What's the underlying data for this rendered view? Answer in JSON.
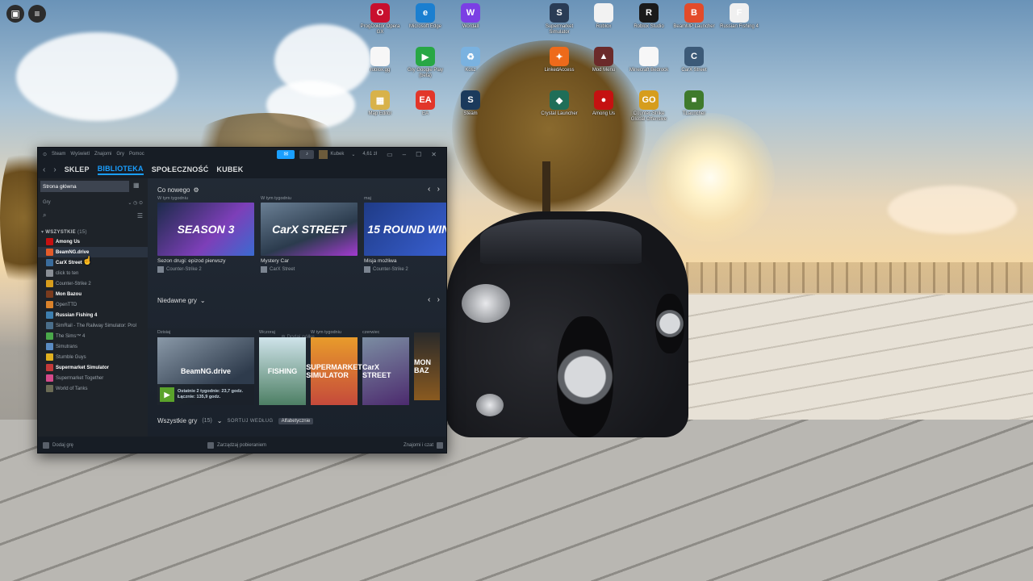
{
  "desktop": {
    "top_left": {
      "home_icon": "roblox-logo-icon",
      "menu_icon": "hamburger-icon"
    },
    "icons": [
      {
        "label": "ProgDoktór Opera GX",
        "color": "#c8102e",
        "glyph": "O",
        "col": 0,
        "row": 0
      },
      {
        "label": "Microsoft Edge",
        "color": "#1b7fd0",
        "glyph": "e",
        "col": 1,
        "row": 0
      },
      {
        "label": "Wordall",
        "color": "#7b3fe4",
        "glyph": "W",
        "col": 2,
        "row": 0
      },
      {
        "label": "Supermarket Simulator",
        "color": "#2a3c55",
        "glyph": "S",
        "col": 4,
        "row": 0
      },
      {
        "label": "Roblox",
        "color": "#f2f2f2",
        "glyph": "",
        "col": 5,
        "row": 0
      },
      {
        "label": "Roblox Studio",
        "color": "#1a1a1a",
        "glyph": "R",
        "col": 6,
        "row": 0
      },
      {
        "label": "BeamMP Launcher",
        "color": "#e34b2a",
        "glyph": "B",
        "col": 7,
        "row": 0
      },
      {
        "label": "Russian Fishing 4",
        "color": "#f0f0f0",
        "glyph": "F",
        "col": 8,
        "row": 0
      },
      {
        "label": "roblox.gg",
        "color": "#f7f7f7",
        "glyph": "",
        "col": 0,
        "row": 1
      },
      {
        "label": "Gry Google Play (beta)",
        "color": "#28a745",
        "glyph": "▶",
        "col": 1,
        "row": 1
      },
      {
        "label": "Kosz",
        "color": "#7ab2e0",
        "glyph": "♻",
        "col": 2,
        "row": 1
      },
      {
        "label": "LinkedAccess",
        "color": "#ee6a1a",
        "glyph": "✦",
        "col": 4,
        "row": 1
      },
      {
        "label": "Mod Menu",
        "color": "#6b2a2a",
        "glyph": "▲",
        "col": 5,
        "row": 1
      },
      {
        "label": "Minecraft Bedrock",
        "color": "#f7f7f7",
        "glyph": "",
        "col": 6,
        "row": 1
      },
      {
        "label": "CarX Street",
        "color": "#3c5a78",
        "glyph": "C",
        "col": 7,
        "row": 1
      },
      {
        "label": "Map Editor",
        "color": "#d8b24a",
        "glyph": "▦",
        "col": 0,
        "row": 2
      },
      {
        "label": "EA",
        "color": "#e2362a",
        "glyph": "EA",
        "col": 1,
        "row": 2
      },
      {
        "label": "Steam",
        "color": "#1b3a5c",
        "glyph": "S",
        "col": 2,
        "row": 2
      },
      {
        "label": "Crystal Launcher",
        "color": "#1f6e58",
        "glyph": "◆",
        "col": 4,
        "row": 2
      },
      {
        "label": "Among Us",
        "color": "#c51111",
        "glyph": "●",
        "col": 5,
        "row": 2
      },
      {
        "label": "Counter-Strike Global Offensive",
        "color": "#d69d1d",
        "glyph": "GO",
        "col": 6,
        "row": 2
      },
      {
        "label": "TLauncher",
        "color": "#3f7a2c",
        "glyph": "■",
        "col": 7,
        "row": 2
      }
    ]
  },
  "steam": {
    "titlebar": {
      "menu": [
        "Steam",
        "Wyświetl",
        "Znajomi",
        "Gry",
        "Pomoc"
      ],
      "user_name": "Kubek",
      "balance": "4,61 zł",
      "notif_icon": "megaphone-icon",
      "bell_icon": "bell-icon"
    },
    "nav": {
      "back": "‹",
      "forward": "›",
      "links": [
        "SKLEP",
        "BIBLIOTEKA",
        "SPOŁECZNOŚĆ",
        "KUBEK"
      ],
      "active": 1
    },
    "sidebar": {
      "home": "Strona główna",
      "filter": "Gry",
      "category": "WSZYSTKIE",
      "category_count": "(15)",
      "games": [
        {
          "name": "Among Us",
          "bold": true,
          "color": "#c51111"
        },
        {
          "name": "BeamNG.drive",
          "bold": true,
          "color": "#e35b2a",
          "selected": true
        },
        {
          "name": "CarX Street",
          "bold": true,
          "color": "#3a6c9c"
        },
        {
          "name": "click to ten",
          "bold": false,
          "color": "#8a8f96"
        },
        {
          "name": "Counter-Strike 2",
          "bold": false,
          "color": "#d69d1d"
        },
        {
          "name": "Mon Bazou",
          "bold": true,
          "color": "#7a3b1e"
        },
        {
          "name": "OpenTTD",
          "bold": false,
          "color": "#d9822b"
        },
        {
          "name": "Russian Fishing 4",
          "bold": true,
          "color": "#3d7fb0"
        },
        {
          "name": "SimRail - The Railway Simulator: Prol",
          "bold": false,
          "color": "#4a6e8a"
        },
        {
          "name": "The Sims™ 4",
          "bold": false,
          "color": "#4aa84a"
        },
        {
          "name": "Simutrans",
          "bold": false,
          "color": "#5a8bc2"
        },
        {
          "name": "Stumble Guys",
          "bold": false,
          "color": "#e0b020"
        },
        {
          "name": "Supermarket Simulator",
          "bold": true,
          "color": "#c43a3a"
        },
        {
          "name": "Supermarket Together",
          "bold": false,
          "color": "#d44a8a"
        },
        {
          "name": "World of Tanks",
          "bold": false,
          "color": "#6b6b55"
        }
      ]
    },
    "whats_new": {
      "title": "Co nowego",
      "cards": [
        {
          "when": "W tym tygodniu",
          "thumb": "SEASON 3",
          "caption": "Sezon drugi: epizod pierwszy",
          "source": "Counter-Strike 2",
          "bg": "linear-gradient(135deg,#1c2b4a,#7d3fb8 60%,#3a6bd1)"
        },
        {
          "when": "W tym tygodniu",
          "thumb": "CarX STREET",
          "caption": "Mystery Car",
          "source": "CarX Street",
          "bg": "linear-gradient(160deg,#6a7f94,#2b3b4d 60%,#a43bd1)"
        },
        {
          "when": "maj",
          "thumb": "15 ROUND WINS",
          "caption": "Misja możliwa",
          "source": "Counter-Strike 2",
          "bg": "linear-gradient(135deg,#1f3b86,#3b63d8)"
        }
      ]
    },
    "add_shelf": "Dodaj półkę",
    "recent": {
      "title": "Niedawne gry",
      "items": [
        {
          "when": "Dzisiaj",
          "thumb": "BeamNG.drive",
          "bg": "linear-gradient(150deg,#8a99a8,#2e3b4c 70%)",
          "width": "120"
        },
        {
          "when": "Wczoraj",
          "thumb": "FISHING",
          "bg": "linear-gradient(180deg,#cfe3ea,#4d7f64)",
          "width": "58"
        },
        {
          "when": "W tym tygodniu",
          "thumb": "SUPERMARKET SIMULATOR",
          "bg": "linear-gradient(180deg,#e89b2b,#c54a3b)",
          "width": "58"
        },
        {
          "when": "czerwiec",
          "thumb": "CarX STREET",
          "bg": "linear-gradient(160deg,#7b8da2,#4c2a6e)",
          "width": "58"
        },
        {
          "when": "",
          "thumb": "MON BAZ",
          "bg": "linear-gradient(180deg,#2a2a2a,#8a5a20)",
          "width": "32"
        }
      ],
      "beam_line1": "Ostatnie 2 tygodnie: 23,7 godz.",
      "beam_line2": "Łącznie: 135,9 godz."
    },
    "all_games": {
      "title": "Wszystkie gry",
      "count": "(15)",
      "sort_label": "SORTUJ WEDŁUG",
      "sort_value": "Alfabetycznie"
    },
    "footer": {
      "add_game": "Dodaj grę",
      "downloads": "Zarządzaj pobieraniem",
      "friends": "Znajomi i czat"
    }
  }
}
